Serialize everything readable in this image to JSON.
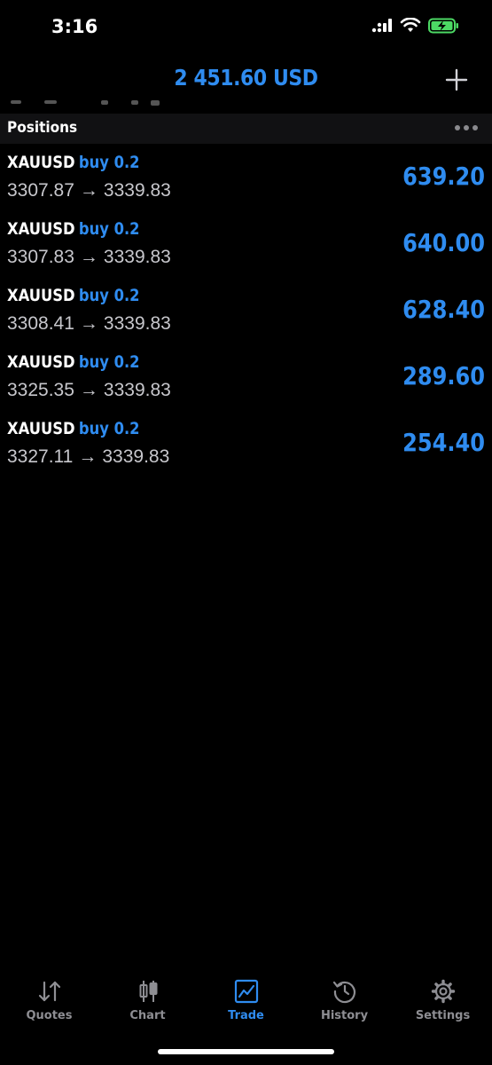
{
  "status_bar": {
    "time": "3:16"
  },
  "header": {
    "balance": "2 451.60 USD"
  },
  "section": {
    "title": "Positions"
  },
  "positions": [
    {
      "symbol": "XAUUSD",
      "type": "buy 0.2",
      "open_price": "3307.87",
      "arrow": "→",
      "current_price": "3339.83",
      "profit": "639.20"
    },
    {
      "symbol": "XAUUSD",
      "type": "buy 0.2",
      "open_price": "3307.83",
      "arrow": "→",
      "current_price": "3339.83",
      "profit": "640.00"
    },
    {
      "symbol": "XAUUSD",
      "type": "buy 0.2",
      "open_price": "3308.41",
      "arrow": "→",
      "current_price": "3339.83",
      "profit": "628.40"
    },
    {
      "symbol": "XAUUSD",
      "type": "buy 0.2",
      "open_price": "3325.35",
      "arrow": "→",
      "current_price": "3339.83",
      "profit": "289.60"
    },
    {
      "symbol": "XAUUSD",
      "type": "buy 0.2",
      "open_price": "3327.11",
      "arrow": "→",
      "current_price": "3339.83",
      "profit": "254.40"
    }
  ],
  "tabs": [
    {
      "label": "Quotes",
      "icon": "quotes-icon",
      "active": false
    },
    {
      "label": "Chart",
      "icon": "candlestick-icon",
      "active": false
    },
    {
      "label": "Trade",
      "icon": "trade-chart-icon",
      "active": true
    },
    {
      "label": "History",
      "icon": "history-icon",
      "active": false
    },
    {
      "label": "Settings",
      "icon": "gear-icon",
      "active": false
    }
  ],
  "colors": {
    "accent": "#2f8cf0",
    "background": "#000000",
    "section_bg": "#111113",
    "secondary_text": "#c7c7cc",
    "tab_inactive": "#8e8e93",
    "battery": "#4cd964"
  }
}
